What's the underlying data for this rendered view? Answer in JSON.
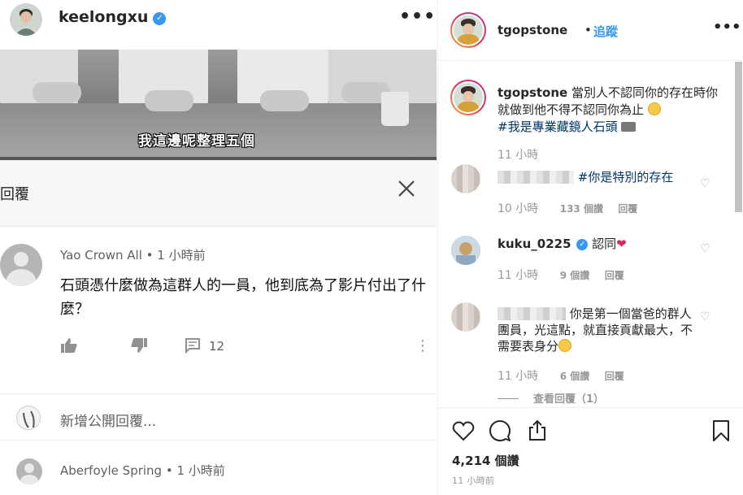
{
  "colors": {
    "accent_blue": "#3897f0",
    "hashtag": "#003569",
    "muted": "#999999"
  },
  "left_post": {
    "username": "keelongxu",
    "verified": true,
    "more_icon": "ellipsis-icon",
    "video_subtitle": "我這邊呢整理五個",
    "reply_panel": {
      "title": "回覆",
      "close_icon": "close-icon"
    },
    "comment": {
      "author": "Yao Crown All",
      "time": "1 小時前",
      "text": "石頭憑什麼做為這群人的一員，他到底為了影片付出了什麼？",
      "reply_count": "12",
      "like_icon": "thumbs-up-icon",
      "dislike_icon": "thumbs-down-icon",
      "reply_icon": "comment-icon",
      "more_icon": "vertical-dots-icon"
    },
    "add_reply_placeholder": "新增公開回覆...",
    "next_comment": {
      "author": "Aberfoyle Spring",
      "time": "1 小時前"
    }
  },
  "right_panel": {
    "header": {
      "username": "tgopstone",
      "separator": "•",
      "follow_label": "追蹤",
      "more_icon": "ellipsis-icon"
    },
    "caption": {
      "username": "tgopstone",
      "text_line1": "當別人不認同你的存在時你就做到他不得不認同你為止",
      "hashtag": "#我是專業藏鏡人石頭",
      "time": "11 小時"
    },
    "comments": [
      {
        "name_hidden": true,
        "text": "#你是特別的存在",
        "time": "10 小時",
        "likes": "133 個讚",
        "reply": "回覆"
      },
      {
        "username": "kuku_0225",
        "verified": true,
        "text": "認同",
        "time": "11 小時",
        "likes": "9 個讚",
        "reply": "回覆"
      },
      {
        "name_hidden": true,
        "text": "你是第一個當爸的群人團員，光這點，就直接貢獻最大，不需要表身分",
        "time": "11 小時",
        "likes": "6 個讚",
        "reply": "回覆",
        "view_replies": "查看回覆（1）"
      }
    ],
    "actions": {
      "like_icon": "heart-icon",
      "comment_icon": "comment-bubble-icon",
      "share_icon": "share-icon",
      "save_icon": "bookmark-icon"
    },
    "likes_count": "4,214 個讚",
    "timestamp": "11 小時前"
  }
}
